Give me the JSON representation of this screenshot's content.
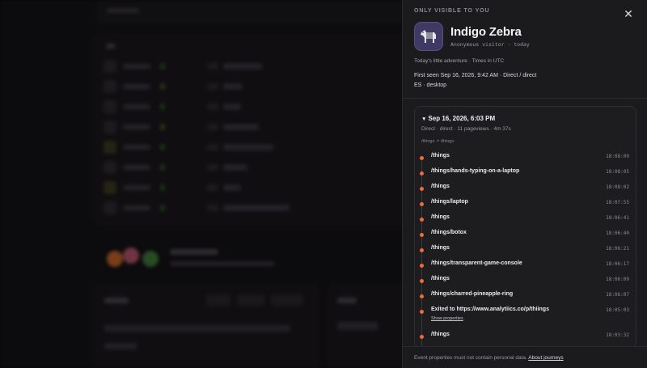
{
  "panel": {
    "only_visible": "ONLY VISIBLE TO YOU",
    "close_icon": "close-icon",
    "avatar_icon": "zebra-icon",
    "visitor_name": "Indigo Zebra",
    "visitor_sub": "Anonymous visitor · today",
    "adventure": "Today's little adventure · Times in UTC",
    "first_seen": "First seen Sep 16, 2026, 9:42 AM · Direct / direct",
    "device": "ES · desktop"
  },
  "session": {
    "date": "Sep 16, 2026, 6:03 PM",
    "meta": "Direct · direct · 11 pageviews · 4m 37s",
    "path": "/things ↗ /things",
    "events": [
      {
        "label": "/things",
        "time": "18:08:09"
      },
      {
        "label": "/things/hands-typing-on-a-laptop",
        "time": "18:08:05"
      },
      {
        "label": "/things",
        "time": "18:08:02"
      },
      {
        "label": "/things/laptop",
        "time": "18:07:55"
      },
      {
        "label": "/things",
        "time": "18:06:41"
      },
      {
        "label": "/things/botox",
        "time": "18:06:40"
      },
      {
        "label": "/things",
        "time": "18:06:21"
      },
      {
        "label": "/things/transparent-game-console",
        "time": "18:06:17"
      },
      {
        "label": "/things",
        "time": "18:06:09"
      },
      {
        "label": "/things/charred-pineapple-ring",
        "time": "18:06:07"
      },
      {
        "label": "Exited to https://www.analytiics.co/p/thiings",
        "time": "18:05:03",
        "action": "Show properties"
      },
      {
        "label": "/things",
        "time": "18:03:32"
      }
    ]
  },
  "footer": {
    "text": "Event properties must not contain personal data.",
    "link": "About journeys"
  },
  "colors": {
    "accent_dot": "#ef6a3c",
    "panel_bg": "#1b1a1d",
    "avatar_bg": "#3f3a63"
  }
}
